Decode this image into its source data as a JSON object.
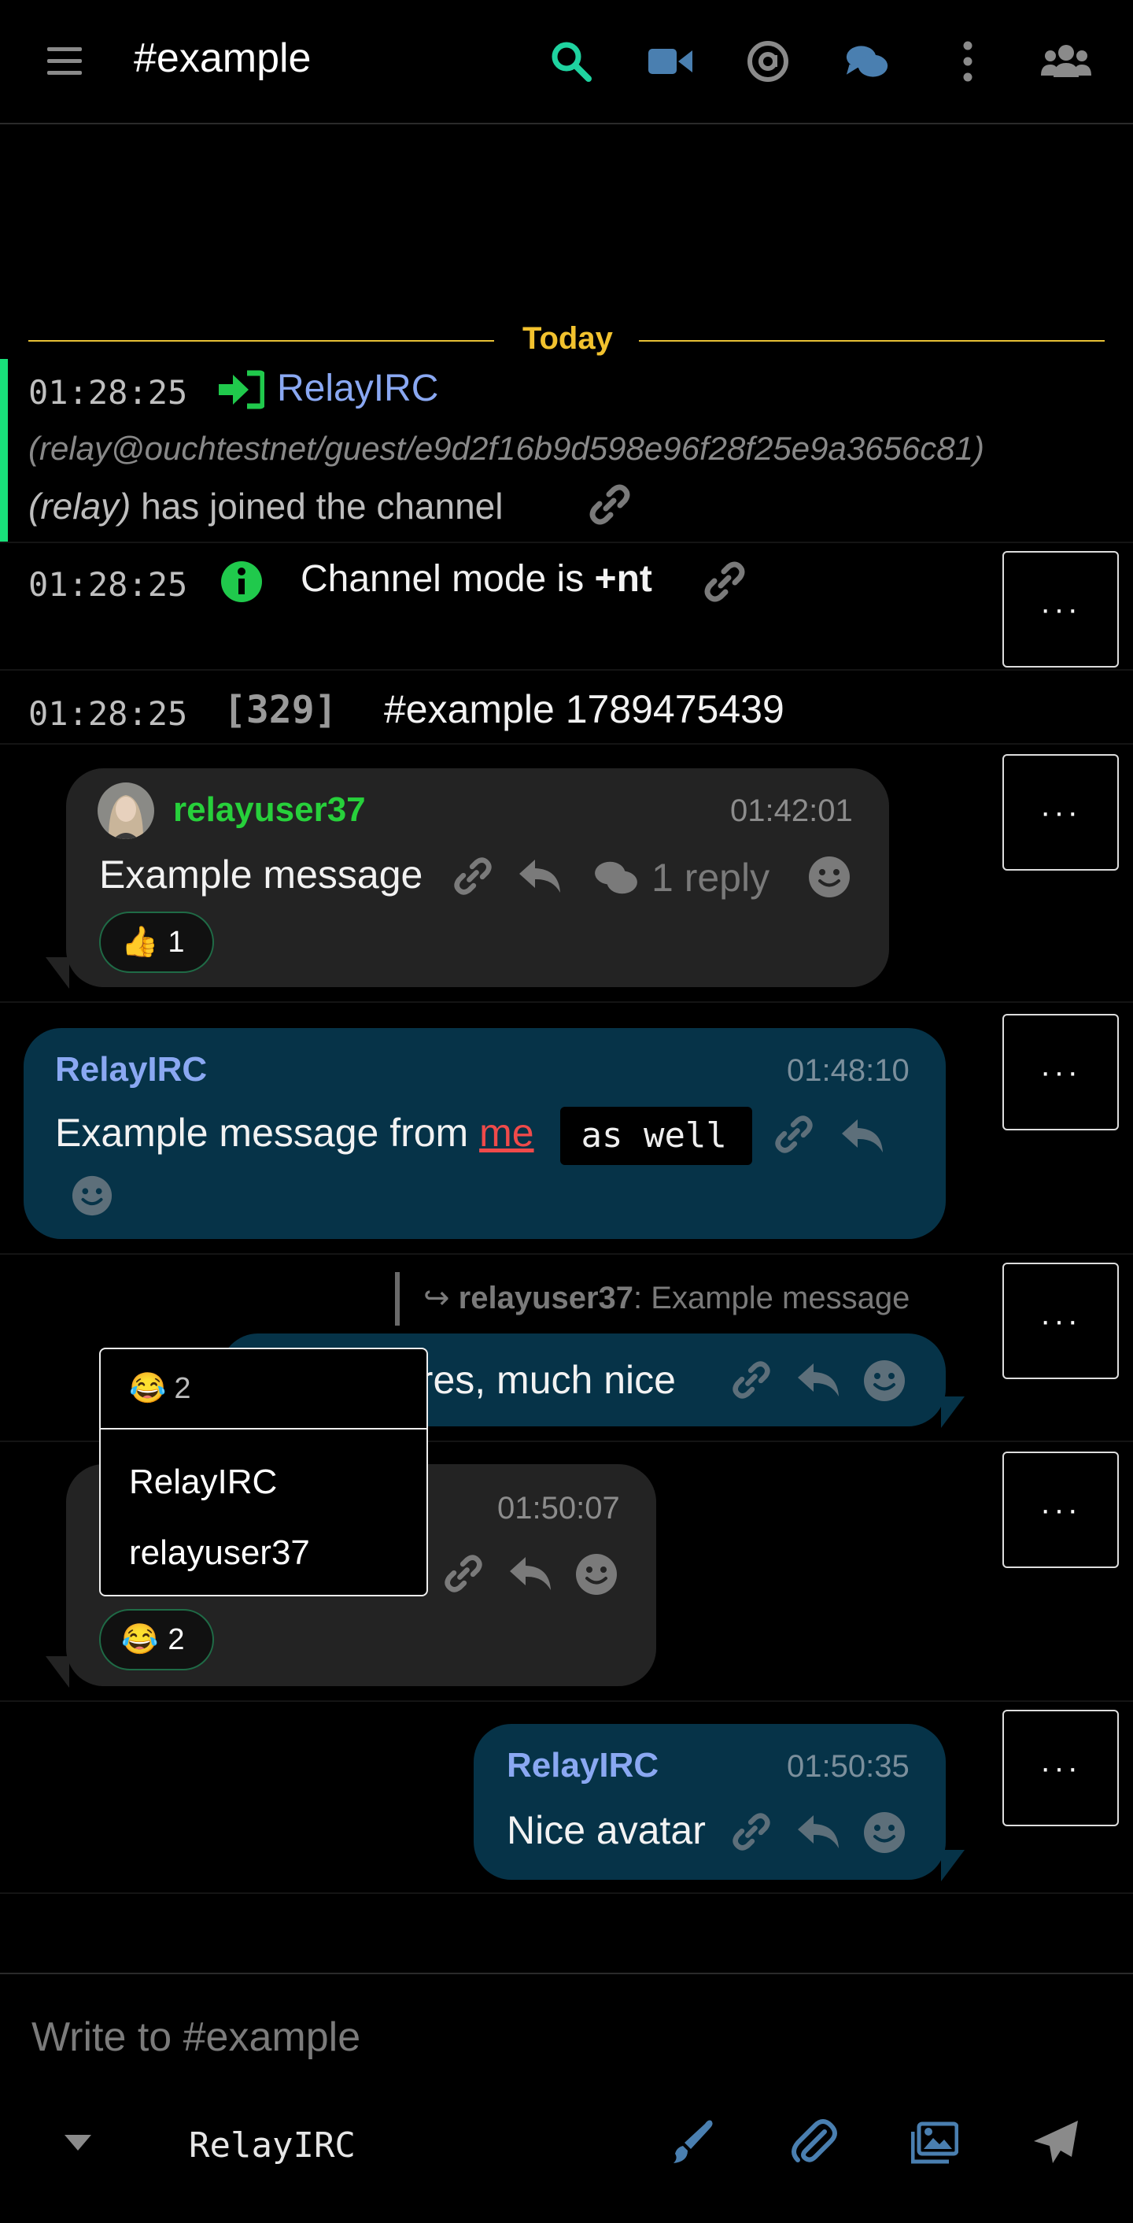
{
  "header": {
    "menu_icon": "hamburger-icon",
    "channel": "#example",
    "icons": [
      "search-icon",
      "video-icon",
      "at-icon",
      "threads-icon",
      "more-vertical-icon",
      "users-icon"
    ],
    "accent": "#1fd3a0"
  },
  "divider": {
    "label": "Today",
    "color": "#f2c22e"
  },
  "events": [
    {
      "time": "01:28:25",
      "nick": "RelayIRC",
      "host": "(relay@ouchtestnet/guest/e9d2f16b9d598e96f28f25e9a3656c81)",
      "ident": "(relay)",
      "text": "has joined the channel"
    },
    {
      "time": "01:28:25",
      "text_prefix": "Channel mode is ",
      "mode": "+nt"
    },
    {
      "time": "01:28:25",
      "code": "[329]",
      "text": "#example 1789475439"
    }
  ],
  "messages": [
    {
      "nick": "relayuser37",
      "time": "01:42:01",
      "text": "Example message",
      "replies": "1 reply",
      "reaction": {
        "emoji": "👍",
        "count": "1"
      }
    },
    {
      "nick": "RelayIRC",
      "time": "01:48:10",
      "text_before": "Example message from ",
      "highlight": "me",
      "code": " as well"
    },
    {
      "quote_nick": "relayuser37",
      "quote_text": ": Example message",
      "text": "ures, much nice"
    },
    {
      "time": "01:50:07",
      "reaction": {
        "emoji": "😂",
        "count": "2"
      }
    },
    {
      "nick": "RelayIRC",
      "time": "01:50:35",
      "text": "Nice avatar"
    }
  ],
  "popup": {
    "emoji": "😂",
    "count": "2",
    "users": [
      "RelayIRC",
      "relayuser37"
    ]
  },
  "more_label": "···",
  "composer": {
    "placeholder": "Write to #example",
    "nick": "RelayIRC"
  }
}
